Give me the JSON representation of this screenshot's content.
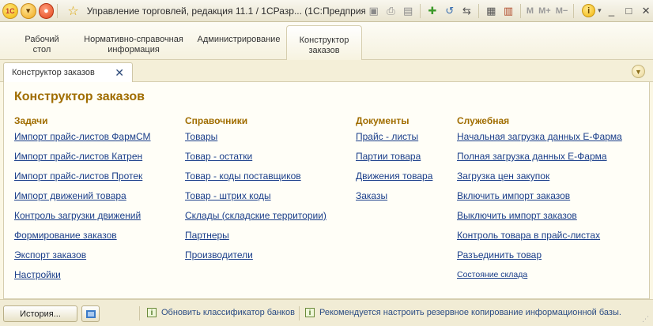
{
  "window": {
    "title": "Управление торговлей, редакция 11.1 / 1СРазр...  (1С:Предприятие)",
    "logo_text": "1С",
    "memory_buttons": [
      "M",
      "M+",
      "M−"
    ],
    "controls": [
      "_",
      "□",
      "✕"
    ]
  },
  "sections": [
    {
      "label": "Рабочий\nстол"
    },
    {
      "label": "Нормативно-справочная\nинформация"
    },
    {
      "label": "Администрирование"
    },
    {
      "label": "Конструктор\nзаказов"
    }
  ],
  "tab": {
    "label": "Конструктор заказов",
    "close": "✕"
  },
  "page": {
    "title": "Конструктор заказов",
    "columns": [
      {
        "heading": "Задачи",
        "links": [
          "Импорт прайс-листов ФармСМ",
          "Импорт прайс-листов Катрен",
          "Импорт прайс-листов Протек",
          "Импорт движений товара",
          "Контроль загрузки движений",
          "Формирование заказов",
          "Экспорт заказов",
          "Настройки"
        ]
      },
      {
        "heading": "Справочники",
        "links": [
          "Товары ",
          "Товар - остатки",
          "Товар - коды поставщиков",
          "Товар - штрих коды",
          "Склады (складские территории)",
          "Партнеры",
          "Производители"
        ]
      },
      {
        "heading": "Документы",
        "links": [
          "Прайс - листы",
          "Партии товара",
          "Движения товара",
          "Заказы"
        ]
      },
      {
        "heading": "Служебная",
        "links": [
          "Начальная загрузка данных Е-Фарма",
          "Полная загрузка данных Е-Фарма",
          "Загрузка цен закупок",
          "Включить импорт заказов",
          "Выключить импорт заказов",
          "Контроль товара в прайс-листах",
          "Разъединить товар",
          "Состояние склада"
        ]
      }
    ]
  },
  "statusbar": {
    "history_label": "История...",
    "messages": [
      "Обновить классификатор банков",
      "Рекомендуется настроить резервное копирование информационной базы."
    ]
  }
}
